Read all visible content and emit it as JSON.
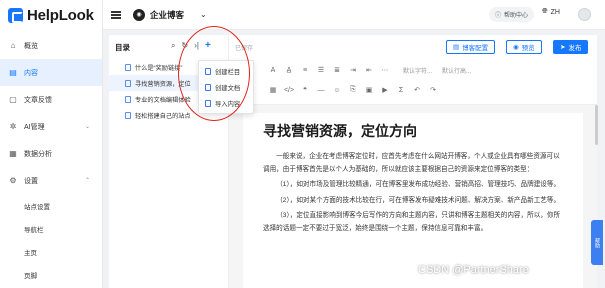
{
  "brand": {
    "name": "HelpLook"
  },
  "sidebar": {
    "items": [
      {
        "label": "概览",
        "icon": "home-icon"
      },
      {
        "label": "内容",
        "icon": "content-icon",
        "active": true
      },
      {
        "label": "文章反馈",
        "icon": "feedback-icon"
      },
      {
        "label": "AI管理",
        "icon": "ai-icon",
        "expandable": true
      },
      {
        "label": "数据分析",
        "icon": "analytics-icon"
      },
      {
        "label": "设置",
        "icon": "settings-icon",
        "expandable": true
      }
    ],
    "sub_items": [
      "站点设置",
      "导航栏",
      "主页",
      "页脚"
    ]
  },
  "topbar": {
    "space_name": "企业博客",
    "help": "帮助中心",
    "lang": "ZH"
  },
  "toc": {
    "title": "目录",
    "items": [
      {
        "label": "什么是“奖励链接”"
      },
      {
        "label": "寻找营销资源，定位",
        "active": true
      },
      {
        "label": "专业的文档编辑体验"
      },
      {
        "label": "轻松搭建自己的站点"
      }
    ]
  },
  "dropdown": {
    "items": [
      "创建栏目",
      "创建文档",
      "导入内容"
    ]
  },
  "editor": {
    "save_hint": "已保存",
    "btn_config": "博客配置",
    "btn_preview": "预览",
    "btn_publish": "发布",
    "select_spacing": "默认字符...",
    "select_line": "默认行高..."
  },
  "document": {
    "title": "寻找营销资源，定位方向",
    "paragraphs": [
      "一般来说，企业在考虑博客定位时，应首先考虑在什么网站开博客，个人或企业具有哪些资源可以调用，由于博客首先是以个人为基础的，所以就应该主要根据自己的资源来定位博客的类型：",
      "（1），如对市场及管理比较精通，可在博客里发布成功经验、营销高招、管理技巧、品牌建设等。",
      "（2），如对某个方面的技术比较在行，可在博客发布疑难技术问题、解决方案、新产品新工艺等。",
      "（3），定位直接影响到博客今后写作的方向和主题内容，只讲和博客主题相关的内容，所以，你所选择的话题一定不要过于宽泛，始终是围绕一个主题，保持信息可靠和丰富。"
    ]
  },
  "right_tab": "帮助",
  "watermark": "CSDN @PartnerShare"
}
